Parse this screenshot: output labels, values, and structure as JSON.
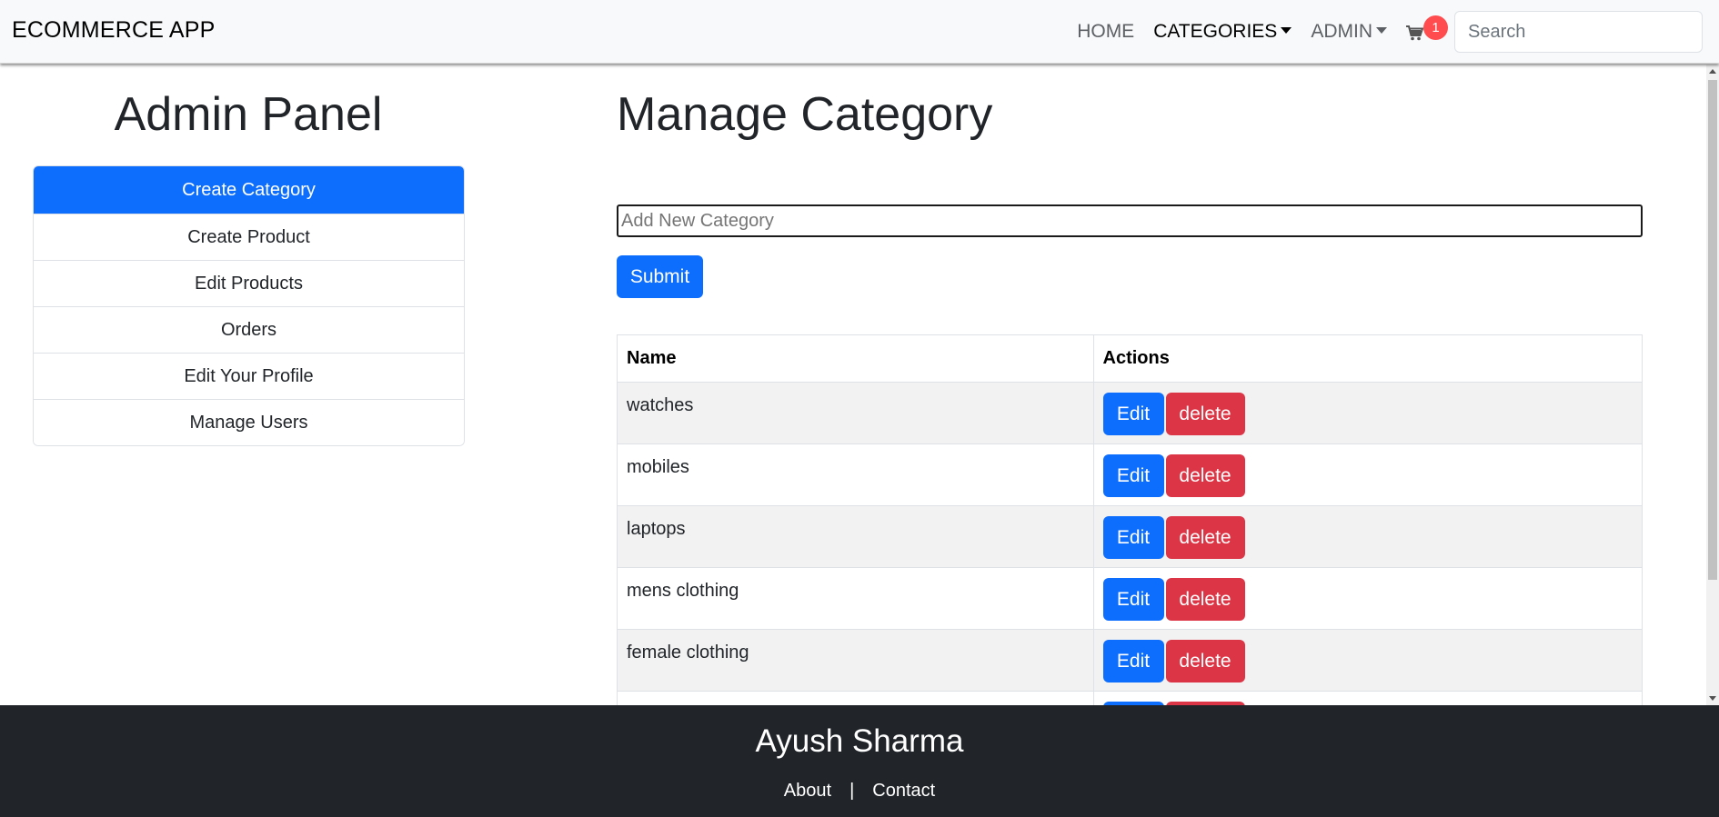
{
  "navbar": {
    "brand": "ECOMMERCE APP",
    "links": {
      "home": "HOME",
      "categories": "CATEGORIES",
      "admin": "ADMIN"
    },
    "cart_count": "1",
    "search_placeholder": "Search"
  },
  "sidebar": {
    "title": "Admin Panel",
    "items": [
      {
        "label": "Create Category",
        "active": true
      },
      {
        "label": "Create Product"
      },
      {
        "label": "Edit Products"
      },
      {
        "label": "Orders"
      },
      {
        "label": "Edit Your Profile"
      },
      {
        "label": "Manage Users"
      }
    ]
  },
  "main": {
    "title": "Manage Category",
    "input_placeholder": "Add New Category",
    "submit_label": "Submit",
    "table": {
      "headers": [
        "Name",
        "Actions"
      ],
      "rows": [
        "watches",
        "mobiles",
        "laptops",
        "mens clothing",
        "female clothing",
        ""
      ],
      "edit_label": "Edit",
      "delete_label": "delete"
    }
  },
  "footer": {
    "name": "Ayush Sharma",
    "about": "About",
    "separator": "|",
    "contact": "Contact"
  },
  "colors": {
    "primary": "#0d6efd",
    "danger": "#dc3545",
    "navbar_bg": "#f8f9fa",
    "footer_bg": "#212529",
    "badge": "#ff4d4f"
  }
}
